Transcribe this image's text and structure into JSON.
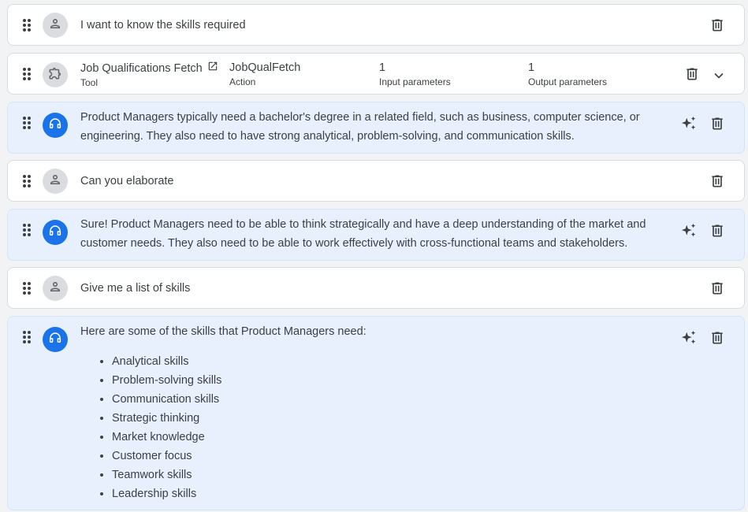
{
  "messages": [
    {
      "role": "user",
      "text": "I want to know the skills required"
    },
    {
      "role": "tool",
      "tool_name": "Job Qualifications Fetch",
      "tool_type": "Tool",
      "action_value": "JobQualFetch",
      "action_label": "Action",
      "input_count": "1",
      "input_label": "Input parameters",
      "output_count": "1",
      "output_label": "Output parameters"
    },
    {
      "role": "bot",
      "text": "Product Managers typically need a bachelor's degree in a related field, such as business, computer science, or engineering. They also need to have strong analytical, problem-solving, and communication skills."
    },
    {
      "role": "user",
      "text": "Can you elaborate"
    },
    {
      "role": "bot",
      "text": "Sure! Product Managers need to be able to think strategically and have a deep understanding of the market and customer needs. They also need to be able to work effectively with cross-functional teams and stakeholders."
    },
    {
      "role": "user",
      "text": "Give me a list of skills"
    },
    {
      "role": "bot",
      "text": "Here are some of the skills that Product Managers need:",
      "list": [
        "Analytical skills",
        "Problem-solving skills",
        "Communication skills",
        "Strategic thinking",
        "Market knowledge",
        "Customer focus",
        "Teamwork skills",
        "Leadership skills"
      ]
    }
  ],
  "icons": {
    "drag": "drag-handle-icon",
    "user": "person-icon",
    "tool": "extension-icon",
    "bot": "headset-icon",
    "delete": "trash-icon",
    "sparkle": "sparkle-icon",
    "expand": "chevron-down-icon",
    "open": "open-in-new-icon"
  },
  "colors": {
    "bot_bg": "#e8f0fe",
    "accent": "#1a73e8",
    "card_bg": "#ffffff"
  }
}
